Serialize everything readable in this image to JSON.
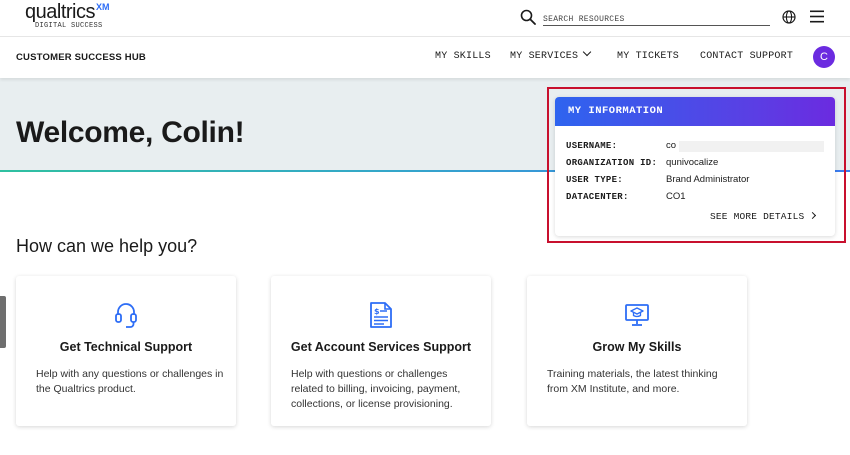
{
  "header": {
    "logo_text": "qualtrics",
    "logo_xm": "XM",
    "logo_subtitle": "DIGITAL SUCCESS",
    "search_placeholder": "SEARCH RESOURCES"
  },
  "nav": {
    "hub_title": "CUSTOMER SUCCESS HUB",
    "items": [
      {
        "label": "MY SKILLS"
      },
      {
        "label": "MY SERVICES"
      },
      {
        "label": "MY TICKETS"
      },
      {
        "label": "CONTACT SUPPORT"
      }
    ],
    "avatar_initial": "C"
  },
  "hero": {
    "welcome": "Welcome, Colin!"
  },
  "my_information": {
    "title": "MY INFORMATION",
    "rows": [
      {
        "label": "USERNAME:",
        "value": "co"
      },
      {
        "label": "ORGANIZATION ID:",
        "value": "qunivocalize"
      },
      {
        "label": "USER TYPE:",
        "value": "Brand Administrator"
      },
      {
        "label": "DATACENTER:",
        "value": "CO1"
      }
    ],
    "see_more": "SEE MORE DETAILS"
  },
  "help": {
    "title": "How can we help you?",
    "cards": [
      {
        "icon": "headset-icon",
        "title": "Get Technical Support",
        "description": "Help with any questions or challenges in the Qualtrics product."
      },
      {
        "icon": "document-dollar-icon",
        "title": "Get Account Services Support",
        "description": "Help with questions or challenges related to billing, invoicing, payment, collections, or license provisioning."
      },
      {
        "icon": "monitor-graduation-icon",
        "title": "Grow My Skills",
        "description": "Training materials, the latest thinking from XM Institute, and more."
      }
    ]
  },
  "colors": {
    "accent": "#2e64ef",
    "avatar": "#6b2be0",
    "highlight": "#c8102e"
  }
}
